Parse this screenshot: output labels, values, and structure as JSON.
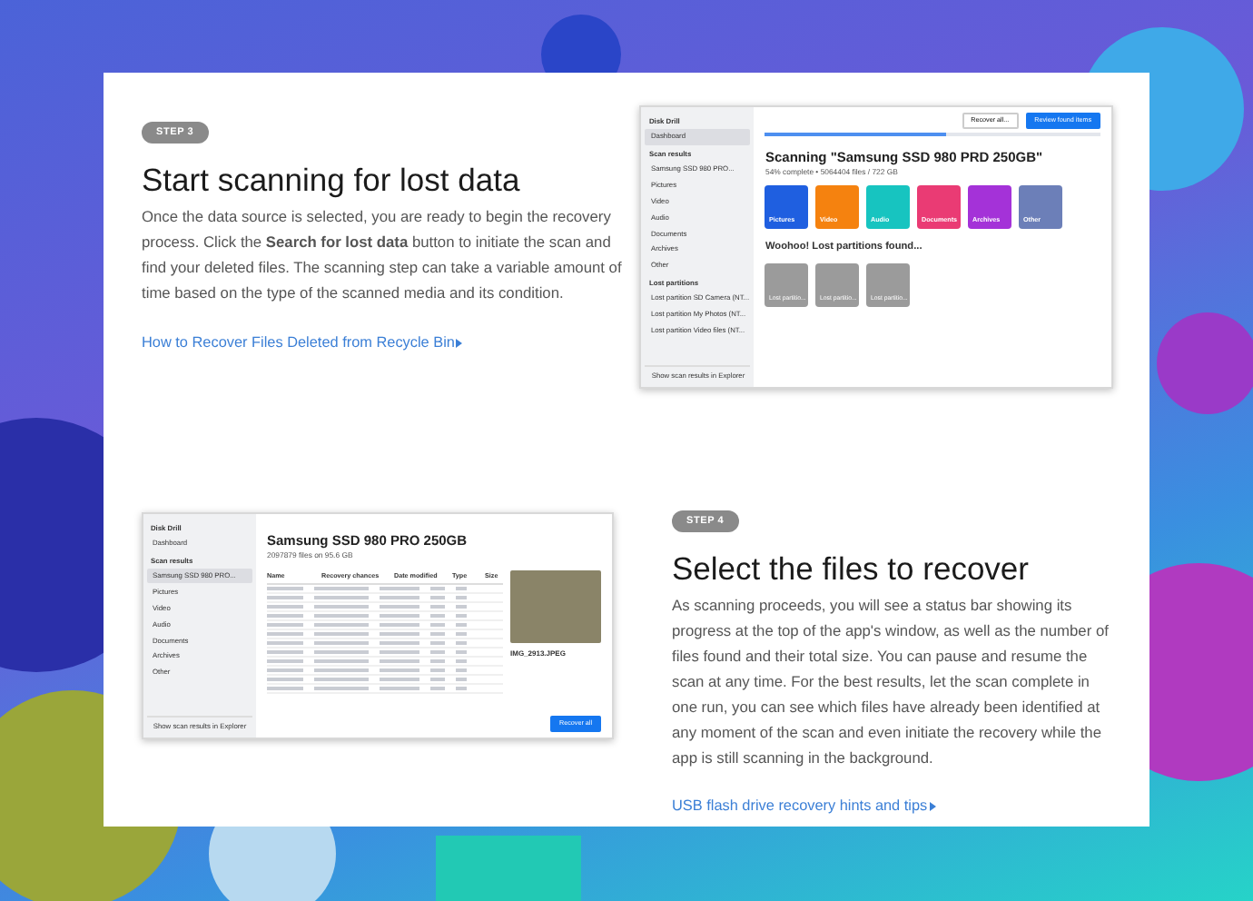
{
  "steps": [
    {
      "badge": "STEP 3",
      "title": "Start scanning for lost data",
      "body": "Once the data source is selected, you are ready to begin the recovery process. Click the **Search for lost data** button to initiate the scan and find your deleted files. The scanning step can take a variable amount of time based on the type of the scanned media and its condition.",
      "link": "How to Recover Files Deleted from Recycle Bin",
      "screenshot": {
        "kind": "dashboard",
        "app_name": "Disk Drill",
        "sidebar": [
          {
            "kind": "item",
            "label": "Dashboard",
            "selected": true
          },
          {
            "kind": "header",
            "label": "Scan results"
          },
          {
            "kind": "item",
            "label": "Samsung SSD 980 PRO...",
            "selected": false
          },
          {
            "kind": "item",
            "label": "Pictures",
            "selected": false
          },
          {
            "kind": "item",
            "label": "Video",
            "selected": false
          },
          {
            "kind": "item",
            "label": "Audio",
            "selected": false
          },
          {
            "kind": "item",
            "label": "Documents",
            "selected": false
          },
          {
            "kind": "item",
            "label": "Archives",
            "selected": false
          },
          {
            "kind": "item",
            "label": "Other",
            "selected": false
          },
          {
            "kind": "header",
            "label": "Lost partitions"
          },
          {
            "kind": "item",
            "label": "Lost partition SD Camera (NT...",
            "selected": false
          },
          {
            "kind": "item",
            "label": "Lost partition My Photos (NT...",
            "selected": false
          },
          {
            "kind": "item",
            "label": "Lost partition Video files (NT...",
            "selected": false
          }
        ],
        "footer": "Show scan results in Explorer",
        "buttons": [
          "Recover all...",
          "Review found items"
        ],
        "heading": "Scanning \"Samsung SSD 980 PRD 250GB\"",
        "progress": "54% complete • 5064404 files / 722 GB",
        "level": 0.54,
        "tiles": [
          {
            "label": "Pictures",
            "color": "#1f5fe0"
          },
          {
            "label": "Video",
            "color": "#f5820f"
          },
          {
            "label": "Audio",
            "color": "#17c4c0"
          },
          {
            "label": "Documents",
            "color": "#ea3b74"
          },
          {
            "label": "Archives",
            "color": "#a432d8"
          },
          {
            "label": "Other",
            "color": "#6c7fb8"
          }
        ],
        "section_title": "Woohoo! Lost partitions found...",
        "partition_tiles": [
          "Lost partitio...",
          "Lost partitio...",
          "Lost partitio..."
        ]
      }
    },
    {
      "badge": "STEP 4",
      "title": "Select the files to recover",
      "body": "As scanning proceeds, you will see a status bar showing its progress at the top of the app's window, as well as the number of files found and their total size. You can pause and resume the scan at any time. For the best results, let the scan complete in one run, you can see which files have already been identified at any moment of the scan and even initiate the recovery while the app is still scanning in the background.",
      "link": "USB flash drive recovery hints and tips",
      "screenshot": {
        "kind": "file-list",
        "app_name": "Disk Drill",
        "sidebar": [
          {
            "kind": "item",
            "label": "Dashboard",
            "selected": false
          },
          {
            "kind": "header",
            "label": "Scan results"
          },
          {
            "kind": "item",
            "label": "Samsung SSD 980 PRO...",
            "selected": true
          },
          {
            "kind": "item",
            "label": "Pictures",
            "selected": false
          },
          {
            "kind": "item",
            "label": "Video",
            "selected": false
          },
          {
            "kind": "item",
            "label": "Audio",
            "selected": false
          },
          {
            "kind": "item",
            "label": "Documents",
            "selected": false
          },
          {
            "kind": "item",
            "label": "Archives",
            "selected": false
          },
          {
            "kind": "item",
            "label": "Other",
            "selected": false
          }
        ],
        "footer": "Show scan results in Explorer",
        "buttons": [
          "Recover all"
        ],
        "heading": "Samsung SSD 980 PRO 250GB",
        "progress": "2097879 files on 95.6 GB",
        "columns": [
          "Name",
          "Recovery chances",
          "Date modified",
          "Type",
          "Size"
        ],
        "preview_title": "IMG_2913.JPEG"
      }
    }
  ]
}
